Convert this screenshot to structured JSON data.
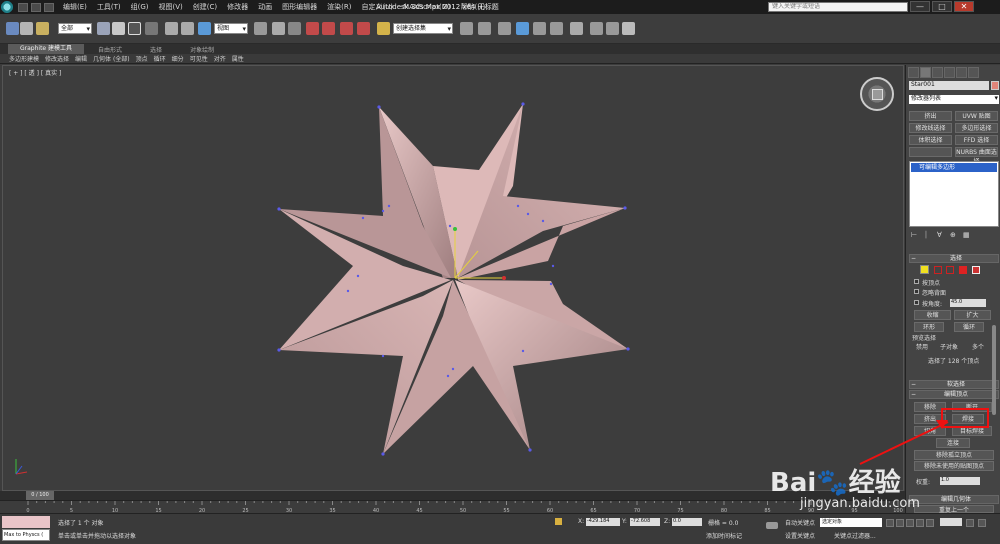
{
  "app": {
    "window_title": "Autodesk 3ds Max  2012 x64     无标题",
    "search_placeholder": "键入关键字或短语",
    "menu": [
      "编辑(E)",
      "工具(T)",
      "组(G)",
      "视图(V)",
      "创建(C)",
      "修改器",
      "动画",
      "图形编辑器",
      "渲染(R)",
      "自定义(U)",
      "MAXScript(M)",
      "帮助(H)"
    ],
    "window_buttons": [
      "—",
      "□",
      "✕"
    ]
  },
  "toolbar": {
    "selection_filter": "全部",
    "ref_coord": "视图",
    "named_selection": "创建选择集"
  },
  "ribbon": {
    "tabs": [
      "Graphite 建模工具",
      "自由形式",
      "选择",
      "对象绘制"
    ],
    "sub_items": [
      "多边形建模",
      "修改选择",
      "编辑",
      "几何体 (全部)",
      "顶点",
      "循环",
      "细分",
      "可见性",
      "对齐",
      "属性"
    ]
  },
  "viewport": {
    "label": "[ + ] [ 透 ] [ 真实 ]"
  },
  "command_panel": {
    "object_name": "Star001",
    "object_color": "#e0857a",
    "modifier_list": "修改器列表",
    "modifier_buttons": [
      "挤出",
      "UVW 贴图",
      "修改线选择",
      "多边形选择",
      "体积选择",
      "FFD 选择",
      "",
      "NURBS 曲面选择"
    ],
    "stack_item": "可编辑多边形",
    "stack_tools": [
      "⊢",
      "⏐",
      "∀",
      "⊕",
      "▦"
    ],
    "rollout_selection": "选择",
    "by_vertex": "按顶点",
    "ignore_backfacing": "忽略背面",
    "by_angle": "按角度:",
    "angle_value": "45.0",
    "shrink": "收缩",
    "grow": "扩大",
    "ring": "环形",
    "loop": "循环",
    "preview_selection": "预览选择",
    "preview_disabled": "禁用",
    "preview_subobject": "子对象",
    "preview_multi": "多个",
    "selected_count": "选择了 128 个顶点",
    "rollout_soft_selection": "软选择",
    "rollout_edit_vertices": "编辑顶点",
    "remove": "移除",
    "break": "断开",
    "extrude": "挤出",
    "weld": "焊接",
    "chamfer": "切角",
    "target_weld": "目标焊接",
    "connect": "连接",
    "remove_isolated": "移除孤立顶点",
    "remove_unused_map": "移除未使用的贴图顶点",
    "weight_label": "权重:",
    "weight_value": "1.0",
    "rollout_edit_geometry": "编辑几何体",
    "repeat_last": "重复上一个"
  },
  "timeline": {
    "frame_label": "0 / 100",
    "ticks": [
      "0",
      "5",
      "10",
      "15",
      "20",
      "25",
      "30",
      "35",
      "40",
      "45",
      "50",
      "55",
      "60",
      "65",
      "70",
      "75",
      "80",
      "85",
      "90",
      "95",
      "100"
    ]
  },
  "status": {
    "maxscript_text": "Max to Physcs (",
    "selected_text": "选择了 1 个 对象",
    "prompt_text": "单击或单击并拖动以选择对象",
    "x_label": "X:",
    "x_value": "-429.184",
    "y_label": "Y:",
    "y_value": "-72.608",
    "z_label": "Z:",
    "z_value": "0.0",
    "grid_text": "栅格 = 0.0",
    "auto_key": "自动关键点",
    "set_key": "设置关键点",
    "key_filters": "关键点过滤器...",
    "add_time_tag": "添加时间标记",
    "anim_dd": "选定对象"
  },
  "watermark": {
    "brand": "Bai",
    "brand2": "经验",
    "url": "jingyan.baidu.com"
  }
}
